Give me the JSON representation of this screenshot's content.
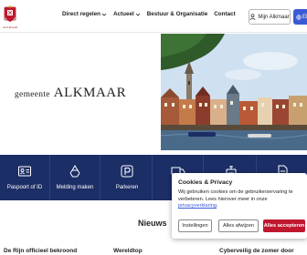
{
  "header": {
    "crest_text": "ALKMAAR",
    "nav": [
      {
        "label": "Direct regelen",
        "has_dropdown": true
      },
      {
        "label": "Actueel",
        "has_dropdown": true
      },
      {
        "label": "Bestuur & Organisatie",
        "has_dropdown": false
      },
      {
        "label": "Contact",
        "has_dropdown": false
      }
    ],
    "my_button": "Mijn Alkmaar",
    "lang_button": "EN"
  },
  "hero": {
    "logo_small": "gemeente",
    "logo_big": "ALKMAAR"
  },
  "tiles": [
    {
      "label": "Paspoort of ID",
      "icon": "id-card-icon"
    },
    {
      "label": "Melding maken",
      "icon": "recycle-icon"
    },
    {
      "label": "Parkeren",
      "icon": "parking-icon"
    },
    {
      "label": "",
      "icon": "truck-icon"
    },
    {
      "label": "",
      "icon": "building-icon"
    },
    {
      "label": "",
      "icon": "document-icon"
    }
  ],
  "news": {
    "title": "Nieuws",
    "cards": [
      "De Rijn officieel bekroond",
      "Wereldtop",
      "Cyberveilig de zomer door"
    ]
  },
  "cookie": {
    "title": "Cookies & Privacy",
    "body": "Wij gebruiken cookies om de gebruikerservaring te verbeteren. Lees hierover meer in onze",
    "link": "privacyverklaring",
    "period": ".",
    "settings": "Instellingen",
    "reject": "Alles afwijzen",
    "accept": "Alles accepteren"
  },
  "colors": {
    "navy": "#1c2e66",
    "accept": "#c0172e",
    "lang": "#3a5ad6"
  }
}
